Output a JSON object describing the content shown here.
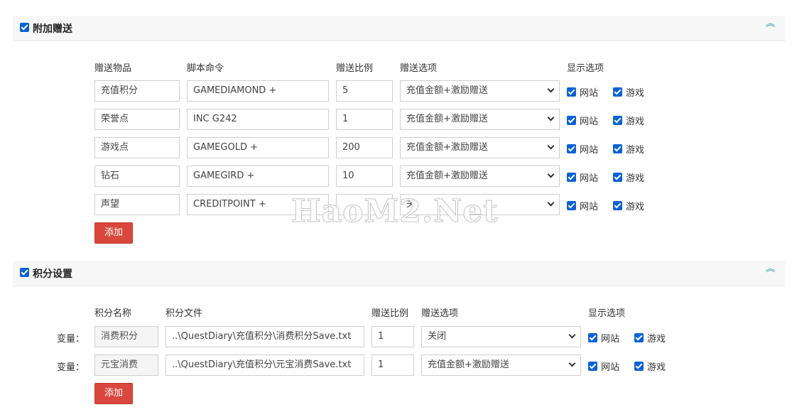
{
  "bonus_section": {
    "title": "附加赠送",
    "columns": [
      "赠送物品",
      "脚本命令",
      "赠送比例",
      "赠送选项",
      "显示选项"
    ],
    "rows": [
      {
        "item": "充值积分",
        "command": "GAMEDIAMOND +",
        "ratio": "5",
        "option": "充值金额+激励赠送",
        "site": "网站",
        "game": "游戏"
      },
      {
        "item": "荣誉点",
        "command": "INC G242",
        "ratio": "1",
        "option": "充值金额+激励赠送",
        "site": "网站",
        "game": "游戏"
      },
      {
        "item": "游戏点",
        "command": "GAMEGOLD +",
        "ratio": "200",
        "option": "充值金额+激励赠送",
        "site": "网站",
        "game": "游戏"
      },
      {
        "item": "钻石",
        "command": "GAMEGIRD +",
        "ratio": "10",
        "option": "充值金额+激励赠送",
        "site": "网站",
        "game": "游戏"
      },
      {
        "item": "声望",
        "command": "CREDITPOINT +",
        "ratio": "",
        "option": "关",
        "site": "网站",
        "game": "游戏"
      }
    ],
    "add_label": "添加"
  },
  "points_section": {
    "title": "积分设置",
    "columns": [
      "积分名称",
      "积分文件",
      "赠送比例",
      "赠送选项",
      "显示选项"
    ],
    "rows": [
      {
        "prefix": "变量：",
        "name": "消费积分",
        "file": "..\\QuestDiary\\充值积分\\消费积分Save.txt",
        "ratio": "1",
        "option": "关闭",
        "site": "网站",
        "game": "游戏"
      },
      {
        "prefix": "变量：",
        "name": "元宝消费",
        "file": "..\\QuestDiary\\充值积分\\元宝消费Save.txt",
        "ratio": "1",
        "option": "充值金额+激励赠送",
        "site": "网站",
        "game": "游戏"
      }
    ],
    "add_label": "添加"
  },
  "watermark": "HaoM2.Net",
  "colors": {
    "checkbox": "#0b62d6",
    "add_button": "#d9473d",
    "collapse_icon": "#1a9a9a"
  }
}
